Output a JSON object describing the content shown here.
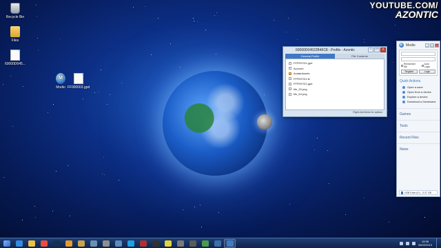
{
  "watermark": {
    "line1": "YOUTUBE.COM/",
    "line2": "AZONTIC"
  },
  "desktop_icons": [
    {
      "label": "Recycle Bin",
      "icon": "recycle-bin-icon"
    },
    {
      "label": "Files",
      "icon": "folder-icon"
    },
    {
      "label": "60000D045...",
      "icon": "file-icon"
    },
    {
      "label": "Modio",
      "icon": "modio-app-icon"
    },
    {
      "label": "FF000003.gpd",
      "icon": "file-icon"
    }
  ],
  "profile_window": {
    "title": "60000D04522B46C8 - Profile - Azontic",
    "tabs": [
      "General Profile",
      "File Contents"
    ],
    "active_tab": 0,
    "files": [
      {
        "name": "FFFE07D1.gpd",
        "type": "file"
      },
      {
        "name": "Account",
        "type": "file"
      },
      {
        "name": "AvatarAssets",
        "type": "folder"
      },
      {
        "name": "FFFE07D1.lb",
        "type": "file"
      },
      {
        "name": "FFFE07D1.gpd",
        "type": "file"
      },
      {
        "name": "tile_32.png",
        "type": "file"
      },
      {
        "name": "tile_64.png",
        "type": "file"
      }
    ],
    "status": "Right click items for options"
  },
  "modio_panel": {
    "title": "Modio",
    "remember_me": "Remember Me",
    "auto_login": "Auto Login",
    "register": "Register",
    "login": "Login",
    "quick_actions_title": "Quick Actions",
    "quick_actions": [
      "Open a save",
      "Open from a device",
      "Explore a device",
      "Download a Gamesave"
    ],
    "sections": [
      "Games",
      "Tools",
      "Recent Files",
      "News"
    ],
    "footer": "USB Drive (E:) - 3.37 GB"
  },
  "taskbar": {
    "apps": [
      {
        "name": "ie-icon",
        "color": "#2f8de4"
      },
      {
        "name": "file-explorer-icon",
        "color": "#f0c040"
      },
      {
        "name": "chrome-icon",
        "color": "#e84d3d"
      },
      {
        "name": "photoshop-icon",
        "color": "#16314f"
      },
      {
        "name": "app-runner-icon",
        "color": "#e89a2a"
      },
      {
        "name": "app-figure-icon",
        "color": "#c9a24a"
      },
      {
        "name": "media-icon",
        "color": "#6b8fb5"
      },
      {
        "name": "app-box-icon",
        "color": "#8f8f8f"
      },
      {
        "name": "app-image-icon",
        "color": "#5c8cc0"
      },
      {
        "name": "skype-icon",
        "color": "#1da1e2"
      },
      {
        "name": "app-game-icon",
        "color": "#b03030"
      },
      {
        "name": "app-dark-icon",
        "color": "#303030"
      },
      {
        "name": "app-2-icon",
        "color": "#e4d23a"
      },
      {
        "name": "app-tile-icon",
        "color": "#7a7a7a"
      },
      {
        "name": "app-monitor-icon",
        "color": "#5a5a5a"
      },
      {
        "name": "app-console-icon",
        "color": "#4a9a4a"
      },
      {
        "name": "app-remote-icon",
        "color": "#3e6fa8"
      },
      {
        "name": "modio-task-icon",
        "color": "#3d7dc7"
      }
    ],
    "running_index": 17,
    "clock_time": "19:36",
    "clock_date": "26/02/2013"
  }
}
